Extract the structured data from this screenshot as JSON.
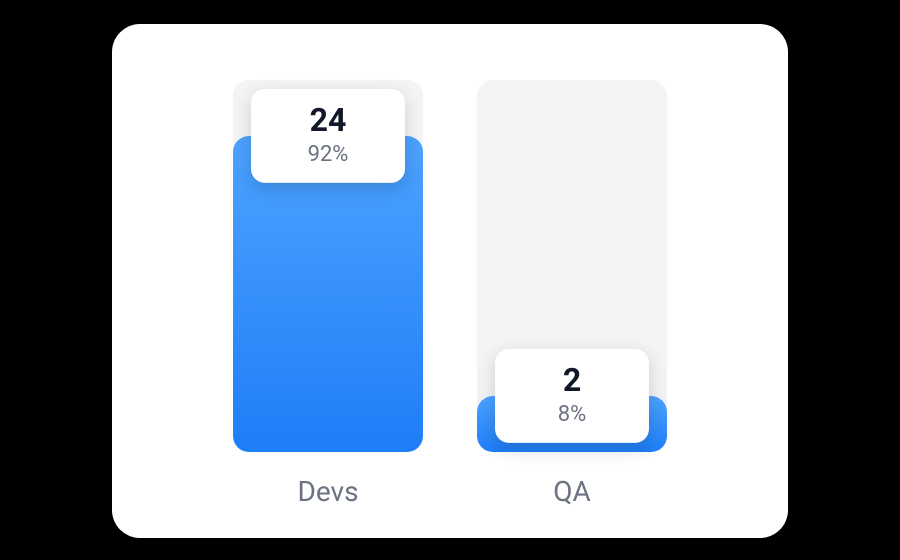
{
  "chart_data": {
    "type": "bar",
    "categories": [
      "Devs",
      "QA"
    ],
    "values": [
      24,
      2
    ],
    "percentages": [
      92,
      8
    ],
    "title": "",
    "xlabel": "",
    "ylabel": "",
    "ylim": [
      0,
      26
    ]
  },
  "bars": [
    {
      "label": "Devs",
      "value_display": "24",
      "percent_display": "92%",
      "fill_height_pct": 85
    },
    {
      "label": "QA",
      "value_display": "2",
      "percent_display": "8%",
      "fill_height_pct": 15
    }
  ],
  "colors": {
    "card_bg": "#FFFFFF",
    "bar_bg": "#F3F4F6",
    "bar_fill_top": "#4DA3FF",
    "bar_fill_bottom": "#1E7EF8",
    "text_muted": "#6B7280",
    "text_strong": "#111827"
  }
}
